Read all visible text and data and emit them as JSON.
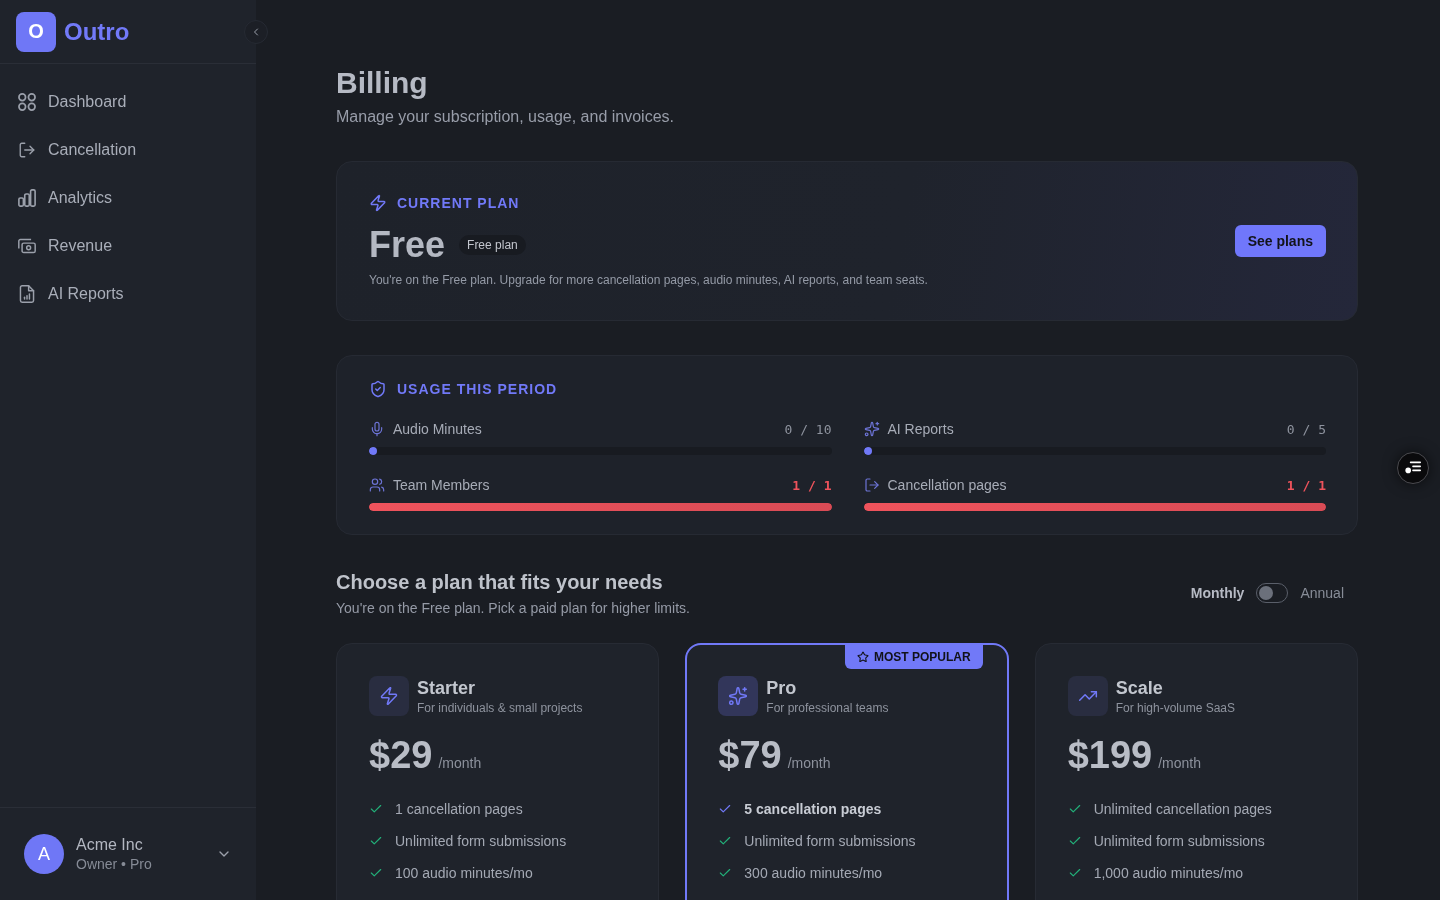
{
  "sidebar": {
    "logo": {
      "letter": "O",
      "name": "Outro"
    },
    "nav_items": [
      {
        "label": "Dashboard",
        "selected": false
      },
      {
        "label": "Cancellation",
        "selected": false
      },
      {
        "label": "Analytics",
        "selected": false
      },
      {
        "label": "Revenue",
        "selected": false
      },
      {
        "label": "AI Reports",
        "selected": false
      }
    ],
    "user": {
      "initial": "A",
      "name": "Acme Inc",
      "role": "Owner • Pro"
    }
  },
  "page": {
    "title": "Billing",
    "subtitle": "Manage your subscription, usage, and invoices."
  },
  "current_plan": {
    "heading": "CURRENT PLAN",
    "plan": "Free",
    "tag": "Free plan",
    "description": "You're on the Free plan. Upgrade for more cancellation pages, audio minutes, AI reports, and team seats.",
    "button": "See plans"
  },
  "usage": {
    "heading": "USAGE THIS PERIOD",
    "meters": [
      {
        "label": "Audio Minutes",
        "reading": "0 / 10",
        "level": 0,
        "at_limit": false
      },
      {
        "label": "AI Reports",
        "reading": "0 / 5",
        "level": 0,
        "at_limit": false
      },
      {
        "label": "Team Members",
        "reading": "1 / 1",
        "level": 1,
        "at_limit": true
      },
      {
        "label": "Cancellation pages",
        "reading": "1 / 1",
        "level": 1,
        "at_limit": true
      }
    ]
  },
  "plans": {
    "title": "Choose a plan that fits your needs",
    "subtitle": "You're on the Free plan. Pick a paid plan for higher limits.",
    "billing_toggle": {
      "left": "Monthly",
      "right": "Annual",
      "annual": false
    },
    "cards": [
      {
        "name": "Starter",
        "tagline": "For individuals & small projects",
        "price": "$29",
        "period": "/month",
        "popular": false,
        "features": [
          {
            "text": "1 cancellation pages",
            "highlight": false
          },
          {
            "text": "Unlimited form submissions",
            "highlight": false
          },
          {
            "text": "100 audio minutes/mo",
            "highlight": false
          }
        ]
      },
      {
        "name": "Pro",
        "tagline": "For professional teams",
        "price": "$79",
        "period": "/month",
        "popular": true,
        "badge": "MOST POPULAR",
        "features": [
          {
            "text": "5 cancellation pages",
            "highlight": true
          },
          {
            "text": "Unlimited form submissions",
            "highlight": false
          },
          {
            "text": "300 audio minutes/mo",
            "highlight": false
          }
        ]
      },
      {
        "name": "Scale",
        "tagline": "For high-volume SaaS",
        "price": "$199",
        "period": "/month",
        "popular": false,
        "features": [
          {
            "text": "Unlimited cancellation pages",
            "highlight": false
          },
          {
            "text": "Unlimited form submissions",
            "highlight": false
          },
          {
            "text": "1,000 audio minutes/mo",
            "highlight": false
          }
        ]
      }
    ]
  }
}
